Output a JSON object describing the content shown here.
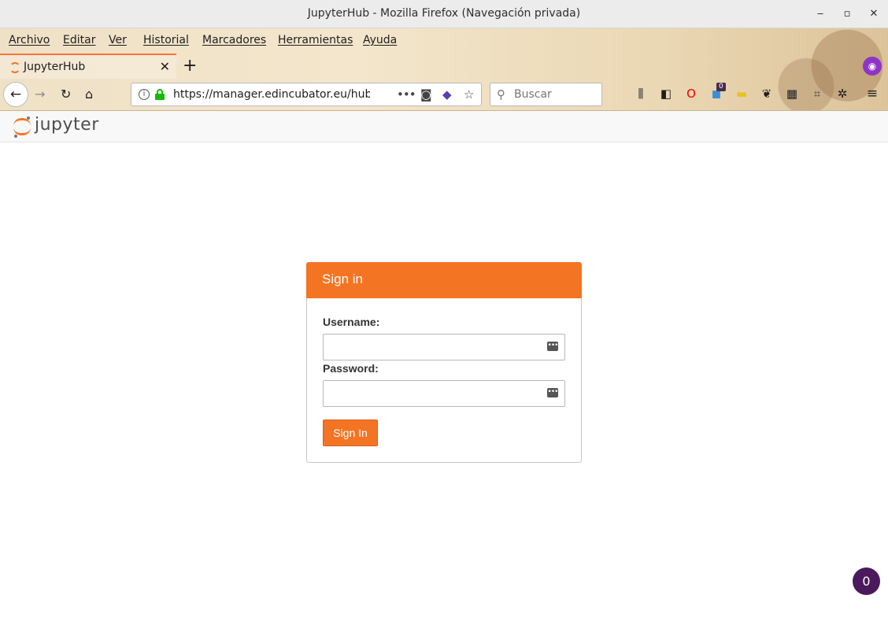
{
  "window": {
    "title": "JupyterHub - Mozilla Firefox (Navegación privada)",
    "minimize": "‒",
    "maximize": "▫",
    "close": "✕"
  },
  "menubar": {
    "items": [
      {
        "label": "Archivo"
      },
      {
        "label": "Editar"
      },
      {
        "label": "Ver"
      },
      {
        "label": "Historial"
      },
      {
        "label": "Marcadores"
      },
      {
        "label": "Herramientas"
      },
      {
        "label": "Ayuda"
      }
    ]
  },
  "tabs": [
    {
      "label": "JupyterHub",
      "close": "✕",
      "active": true
    }
  ],
  "new_tab": "+",
  "navbar": {
    "back": "←",
    "forward": "→",
    "reload": "↻",
    "home": "⌂",
    "url": "https://manager.edincubator.eu/hub/lo",
    "page_actions": "•••",
    "search_placeholder": "Buscar",
    "extension_badge": "0"
  },
  "jupyter": {
    "wordmark": "jupyter"
  },
  "signin": {
    "title": "Sign in",
    "username_label": "Username:",
    "username_value": "",
    "password_label": "Password:",
    "password_value": "",
    "button_label": "Sign In"
  },
  "floating_badge": "0",
  "colors": {
    "jupyter_orange": "#f37524",
    "private_purple": "#8f34c9",
    "badge_purple": "#4a1a5c"
  }
}
